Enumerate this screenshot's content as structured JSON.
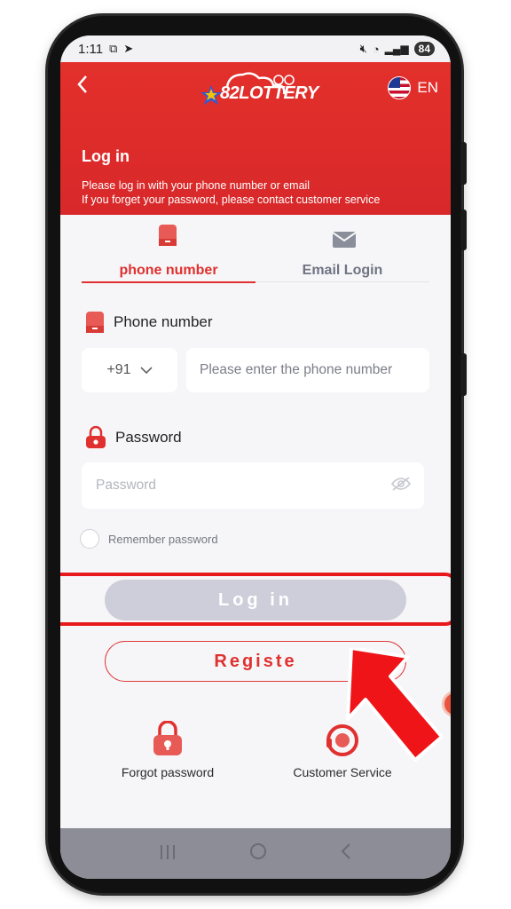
{
  "status_bar": {
    "time": "1:11",
    "battery": "84"
  },
  "header": {
    "logo_text": "82LOTTERY",
    "language": "EN",
    "title": "Log in",
    "description_line1": "Please log in with your phone number or email",
    "description_line2": "If you forget your password, please contact customer service"
  },
  "tabs": [
    {
      "label": "phone number",
      "icon": "phone-icon",
      "active": true
    },
    {
      "label": "Email Login",
      "icon": "envelope-icon",
      "active": false
    }
  ],
  "phone_field": {
    "label": "Phone number",
    "country_code": "+91",
    "placeholder": "Please enter the phone number"
  },
  "password_field": {
    "label": "Password",
    "placeholder": "Password"
  },
  "remember": {
    "label": "Remember password",
    "checked": false
  },
  "buttons": {
    "login": "Log in",
    "register": "Registe"
  },
  "bottom_links": [
    {
      "label": "Forgot password",
      "icon": "lock-icon"
    },
    {
      "label": "Customer Service",
      "icon": "headset-icon"
    }
  ],
  "colors": {
    "brand_red": "#e0302f",
    "disabled_button": "#cdced9",
    "highlight": "#e8181c"
  }
}
